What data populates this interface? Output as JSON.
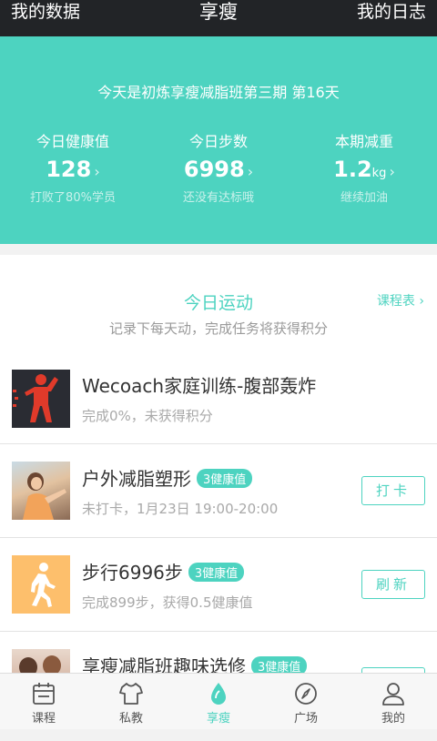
{
  "header": {
    "left_link": "我的数据",
    "title": "享瘦",
    "right_link": "我的日志"
  },
  "hero": {
    "banner": "今天是初炼享瘦减脂班第三期  第16天",
    "stats": [
      {
        "label": "今日健康值",
        "value": "128",
        "unit": "",
        "sub": "打败了80%学员"
      },
      {
        "label": "今日步数",
        "value": "6998",
        "unit": "",
        "sub": "还没有达标哦"
      },
      {
        "label": "本期减重",
        "value": "1.2",
        "unit": "kg",
        "sub": "继续加油"
      }
    ]
  },
  "today": {
    "title": "今日运动",
    "subtitle": "记录下每天动，完成任务将获得积分",
    "schedule_link": "课程表"
  },
  "activities": [
    {
      "name": "Wecoach家庭训练-腹部轰炸",
      "badge": "",
      "desc": "完成0%，未获得积分",
      "button": ""
    },
    {
      "name": "户外减脂塑形",
      "badge": "3健康值",
      "desc": "未打卡，1月23日  19:00-20:00",
      "button": "打卡"
    },
    {
      "name": "步行6996步",
      "badge": "3健康值",
      "desc": "完成899步，获得0.5健康值",
      "button": "刷新"
    },
    {
      "name": "享瘦减脂班趣味选修",
      "badge": "3健康值",
      "desc": "",
      "button": ""
    }
  ],
  "tabs": [
    {
      "label": "课程",
      "icon": "calendar-icon"
    },
    {
      "label": "私教",
      "icon": "shirt-icon"
    },
    {
      "label": "享瘦",
      "icon": "drop-icon"
    },
    {
      "label": "广场",
      "icon": "compass-icon"
    },
    {
      "label": "我的",
      "icon": "person-icon"
    }
  ],
  "colors": {
    "accent": "#4dd3c0",
    "topbar": "#222427"
  }
}
